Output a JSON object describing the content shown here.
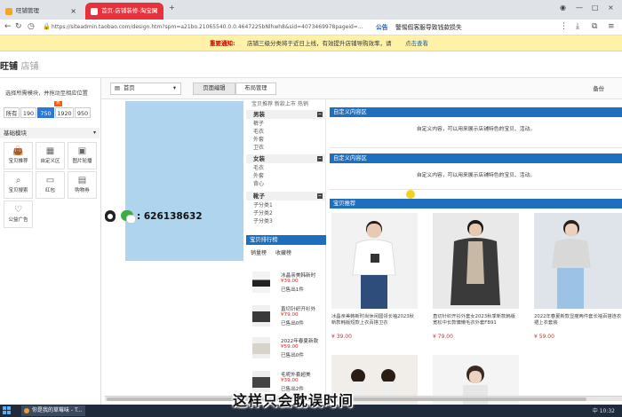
{
  "browser": {
    "tabs": [
      {
        "label": "旺铺管理"
      },
      {
        "label": "首页-店铺装修-淘宝网"
      }
    ],
    "url": "https://siteadmin.taobao.com/design.htm?spm=a21bo.21065540.0.0.4647225bNlhwh8&sid=4073469978pageid=...",
    "notice_label": "公告",
    "notice_text": "警惕假客服导致钱款损失"
  },
  "banner": {
    "title": "重要通知:",
    "text": "店铺三级分类将于近日上线，有效提升店铺导购效率，请",
    "link": "点击查看"
  },
  "header": {
    "logo": "旺铺",
    "logo_sub": "店铺"
  },
  "left_panel": {
    "hint": "选择所需模块，并拖动至相应位置",
    "widths": [
      "所有",
      "190",
      "750",
      "1920",
      "950"
    ],
    "selected_width": "750",
    "hot_badge": "热",
    "section_title": "基础模块",
    "modules": [
      {
        "label": "宝贝推荐",
        "icon": "bag-icon"
      },
      {
        "label": "自定义区",
        "icon": "grid-icon"
      },
      {
        "label": "图片轮播",
        "icon": "image-icon"
      },
      {
        "label": "宝贝搜索",
        "icon": "search-icon"
      },
      {
        "label": "红包",
        "icon": "envelope-icon"
      },
      {
        "label": "购物券",
        "icon": "coupon-icon"
      },
      {
        "label": "公益广告",
        "icon": "heart-icon"
      }
    ]
  },
  "toolbar": {
    "page_select": "首页",
    "tabs": [
      "页面编辑",
      "布局管理"
    ],
    "active_tab": "页面编辑",
    "backup": "备份"
  },
  "contact": {
    "qq_number": ": 626138632"
  },
  "category": {
    "top_cut": "宝贝推荐 新款上市 热销",
    "groups": [
      {
        "name": "男装",
        "items": [
          "裤子",
          "毛衣",
          "外套",
          "卫衣"
        ]
      },
      {
        "name": "女装",
        "items": [
          "毛衣",
          "外套",
          "背心"
        ]
      },
      {
        "name": "靴子",
        "items": [
          "子分类1",
          "子分类2",
          "子分类3"
        ]
      }
    ]
  },
  "ranking": {
    "title": "宝贝排行榜",
    "tabs": [
      "销量榜",
      "收藏榜"
    ],
    "items": [
      {
        "name": "冰晶亲美韩新时",
        "price": "¥39.00",
        "sold": "已售出1件"
      },
      {
        "name": "直切针织开衫外",
        "price": "¥79.00",
        "sold": "已售出0件"
      },
      {
        "name": "2022年春夏新款",
        "price": "¥59.00",
        "sold": "已售出0件"
      },
      {
        "name": "毛呢外套超美",
        "price": "¥39.00",
        "sold": "已售出2件"
      }
    ]
  },
  "main": {
    "custom_title": "自定义内容区",
    "custom_text": "自定义内容，可以用来展示店铺特色的宝贝、活动。",
    "recommend_title": "宝贝推荐",
    "products": [
      {
        "name": "冰晶亲美韩新时尚休闲圆领长袖2023秋新款韩版短款上衣百搭卫衣",
        "price": "¥ 39.00"
      },
      {
        "name": "直切针织开衫外套女2023秋季新款韩版宽松中长款慵懒毛衣外套FB91",
        "price": "¥ 79.00"
      },
      {
        "name": "2022年春夏新款显瘦两件套长袖百搭连衣裙上衣套装",
        "price": "¥ 59.00"
      }
    ]
  },
  "taskbar": {
    "app": "你是我的草莓味 - T...",
    "tray": "中 10:32"
  },
  "overlay_subtitle": "这样只会耽误时间",
  "colors": {
    "accent_blue": "#1f6fbf",
    "tab_red": "#e8313b",
    "banner_yellow": "#fff1a8",
    "price_red": "#c33"
  }
}
